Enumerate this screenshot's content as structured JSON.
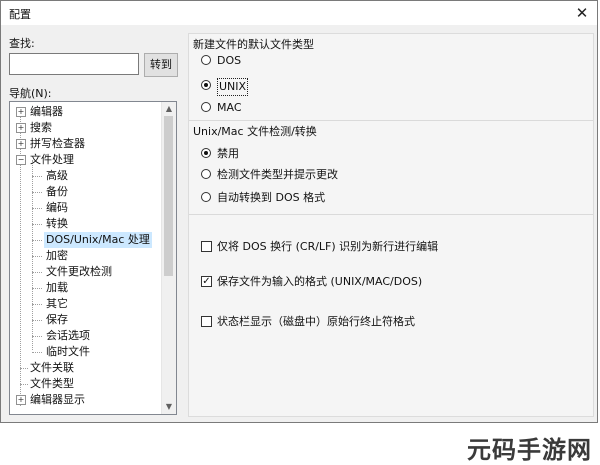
{
  "window": {
    "title": "配置",
    "close_glyph": "✕"
  },
  "search": {
    "label": "查找:",
    "value": "",
    "button_label": "转到"
  },
  "nav": {
    "label": "导航(N):",
    "items": [
      {
        "label": "编辑器",
        "expander": "+"
      },
      {
        "label": "搜索",
        "expander": "+"
      },
      {
        "label": "拼写检查器",
        "expander": "+"
      },
      {
        "label": "文件处理",
        "expander": "−"
      },
      {
        "label": "高级"
      },
      {
        "label": "备份"
      },
      {
        "label": "编码"
      },
      {
        "label": "转换"
      },
      {
        "label": "DOS/Unix/Mac 处理",
        "selected": true
      },
      {
        "label": "加密"
      },
      {
        "label": "文件更改检测"
      },
      {
        "label": "加载"
      },
      {
        "label": "其它"
      },
      {
        "label": "保存"
      },
      {
        "label": "会话选项"
      },
      {
        "label": "临时文件"
      },
      {
        "label": "文件关联"
      },
      {
        "label": "文件类型"
      },
      {
        "label": "编辑器显示",
        "expander": "+"
      }
    ]
  },
  "default_type": {
    "heading": "新建文件的默认文件类型",
    "options": [
      {
        "label": "DOS",
        "checked": false
      },
      {
        "label": "UNIX",
        "checked": true
      },
      {
        "label": "MAC",
        "checked": false
      }
    ]
  },
  "detect": {
    "heading": "Unix/Mac 文件检测/转换",
    "options": [
      {
        "label": "禁用",
        "checked": true
      },
      {
        "label": "检测文件类型并提示更改",
        "checked": false
      },
      {
        "label": "自动转换到 DOS 格式",
        "checked": false
      }
    ]
  },
  "checkboxes": [
    {
      "label": "仅将 DOS 换行 (CR/LF) 识别为新行进行编辑",
      "checked": false
    },
    {
      "label": "保存文件为输入的格式 (UNIX/MAC/DOS)",
      "checked": true
    },
    {
      "label": "状态栏显示（磁盘中）原始行终止符格式",
      "checked": false
    }
  ],
  "watermark": "元码手游网"
}
